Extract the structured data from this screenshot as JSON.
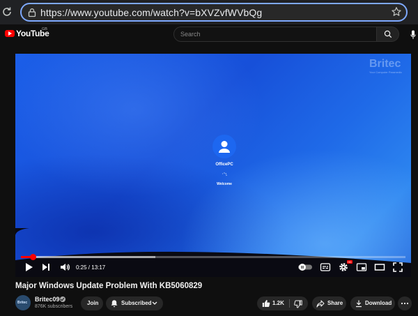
{
  "browser": {
    "url": "https://www.youtube.com/watch?v=bXVZvfWVbQg",
    "icons": [
      "reload-icon",
      "site-info-icon",
      "bookmark-star-icon"
    ]
  },
  "header": {
    "logo_text": "YouTube",
    "country_code": "GB",
    "search_placeholder": "Search",
    "icons": [
      "youtube-logo-icon",
      "search-icon",
      "microphone-icon"
    ]
  },
  "player": {
    "watermark_text": "Britec",
    "watermark_subtext": "Your Computer Paramedic",
    "account_name": "OfficePC",
    "status_text": "Welcome",
    "time_display": "0:25 / 13:17",
    "progress_fraction": 0.0314,
    "buffered_fraction": 0.35,
    "hd_badge": "HD",
    "accent_color": "#ff0000",
    "icons": [
      "play-icon",
      "next-icon",
      "volume-icon",
      "autoplay-toggle-icon",
      "subtitles-icon",
      "settings-icon",
      "miniplayer-icon",
      "theater-icon",
      "fullscreen-icon"
    ]
  },
  "video": {
    "title": "Major Windows Update Problem With KB5060829",
    "channel_name": "Britec09",
    "subscribers": "876K subscribers",
    "join_label": "Join",
    "subscribed_label": "Subscribed",
    "like_count": "1.2K",
    "share_label": "Share",
    "download_label": "Download",
    "icons": [
      "channel-avatar",
      "verified-icon",
      "bell-icon",
      "chevron-down-icon",
      "thumbs-up-icon",
      "thumbs-down-icon",
      "share-icon",
      "download-icon",
      "more-icon"
    ]
  }
}
